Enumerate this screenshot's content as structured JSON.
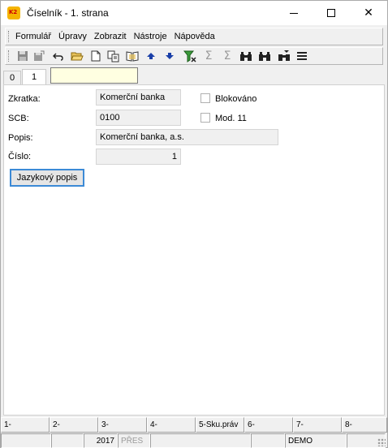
{
  "window": {
    "title": "Číselník - 1. strana"
  },
  "menu": {
    "items": [
      "Formulář",
      "Úpravy",
      "Zobrazit",
      "Nástroje",
      "Nápověda"
    ]
  },
  "toolbar": {
    "icons": [
      "save-icon",
      "save-as-icon",
      "undo-icon",
      "open-folder-icon",
      "new-document-icon",
      "copy-icon",
      "book-icon",
      "arrow-up-icon",
      "arrow-down-icon",
      "filter-icon",
      "sum-icon",
      "sum-alt-icon",
      "binoculars-icon",
      "binoculars-next-icon",
      "binoculars-filter-icon",
      "list-icon"
    ]
  },
  "tabs": {
    "items": [
      "0",
      "1"
    ],
    "active": "1",
    "search_value": ""
  },
  "form": {
    "zkratka_label": "Zkratka:",
    "zkratka_value": "Komerční banka",
    "scb_label": "SCB:",
    "scb_value": "0100",
    "popis_label": "Popis:",
    "popis_value": "Komerční banka, a.s.",
    "cislo_label": "Číslo:",
    "cislo_value": "1",
    "blokovano_label": "Blokováno",
    "mod_label": "Mod. 11",
    "lang_button": "Jazykový popis"
  },
  "fkeys": [
    "1-",
    "2-",
    "3-",
    "4-",
    "5-Sku.práv",
    "6-",
    "7-",
    "8-"
  ],
  "status": {
    "year": "2017",
    "mode": "PŘES",
    "db": "DEMO"
  },
  "colors": {
    "accent": "#3c8ad6",
    "search_bg": "#ffffe1",
    "arrow": "#1a3fa8"
  }
}
